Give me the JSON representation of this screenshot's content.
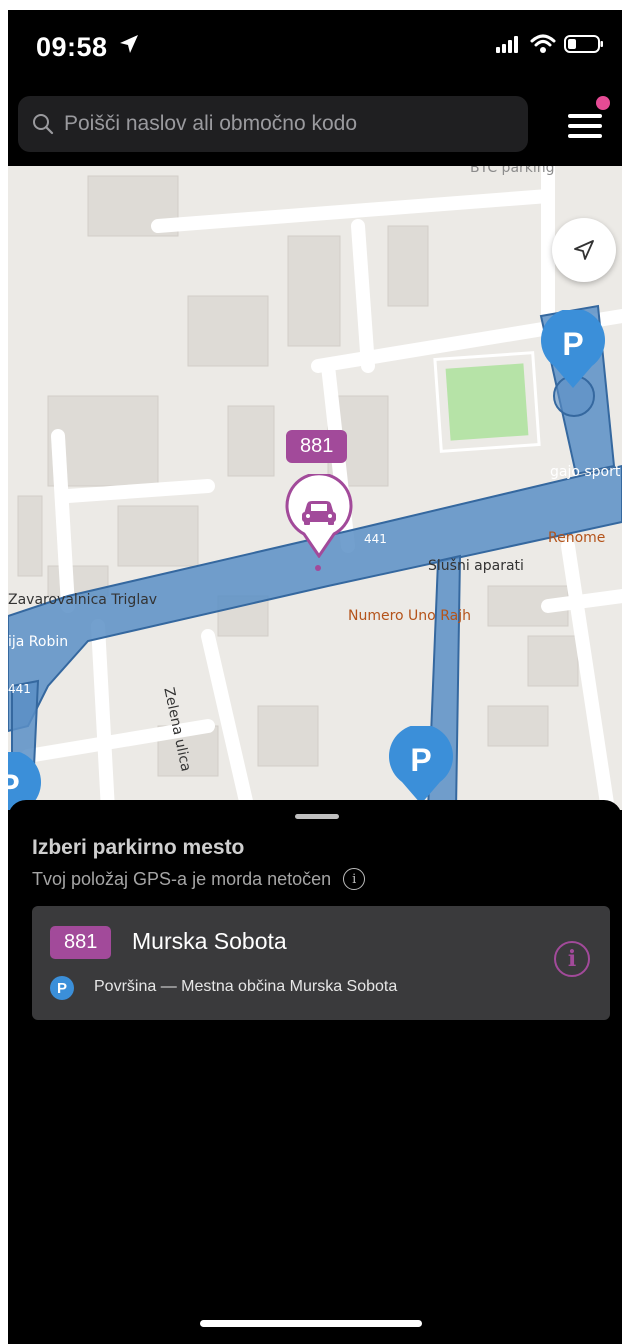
{
  "status_bar": {
    "time": "09:58"
  },
  "search": {
    "placeholder": "Poišči naslov ali območno kodo"
  },
  "map": {
    "zone_badge": "881",
    "labels": {
      "btc": "BTC parking",
      "gajo": "gajo sport",
      "renome": "Renome",
      "slusni": "Slušni aparati",
      "numero": "Numero Uno Rajh",
      "zavar": "Zavarovalnica Triglav",
      "robin": "ija Robin",
      "zelena": "Zelena ulica",
      "road_441": "441",
      "road_441_left": "441"
    },
    "parking_letter": "P"
  },
  "sheet": {
    "title": "Izberi parkirno mesto",
    "subtitle": "Tvoj položaj GPS-a je morda netočen",
    "info_glyph": "i",
    "card": {
      "zone_code": "881",
      "name": "Murska Sobota",
      "parking_letter": "P",
      "description": "Površina — Mestna občina Murska Sobota",
      "info_glyph": "i"
    }
  },
  "colors": {
    "accent": "#a24a9a",
    "parking_blue": "#3b8fd9",
    "zone_fill": "#5b8fc6",
    "notification": "#e64b95"
  }
}
